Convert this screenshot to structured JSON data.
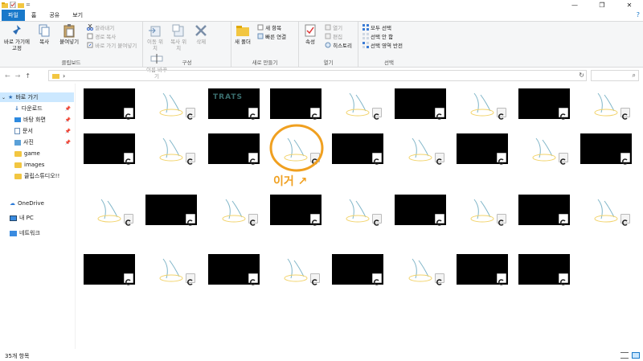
{
  "window": {
    "quick_access_arrow": "=",
    "controls": {
      "minimize": "—",
      "maximize": "❐",
      "close": "✕"
    }
  },
  "tabs": [
    {
      "label": "파일"
    },
    {
      "label": "홈"
    },
    {
      "label": "공유"
    },
    {
      "label": "보기"
    }
  ],
  "help": "?",
  "ribbon": {
    "clipboard": {
      "pin_label": "바로 가기에 고정",
      "copy_label": "복사",
      "paste_label": "붙여넣기",
      "cut_label": "잘라내기",
      "copy_path_label": "경로 복사",
      "paste_shortcut_label": "바로 가기 붙여넣기",
      "group_label": "클립보드"
    },
    "organize": {
      "move_label": "이동 위치",
      "copy_to_label": "복사 위치",
      "delete_label": "삭제",
      "rename_label": "이름 바꾸기",
      "group_label": "구성"
    },
    "new": {
      "new_folder_label": "새 폴더",
      "new_item_label": "새 항목",
      "easy_access_label": "빠른 연결",
      "group_label": "새로 만들기"
    },
    "open": {
      "properties_label": "속성",
      "open_label": "열기",
      "edit_label": "편집",
      "history_label": "히스토리",
      "group_label": "열기"
    },
    "select": {
      "select_all_label": "모두 선택",
      "select_none_label": "선택 안 함",
      "invert_label": "선택 영역 반전",
      "group_label": "선택"
    }
  },
  "address": {
    "back": "←",
    "forward": "→",
    "up": "↑",
    "chevron": "›",
    "refresh": "↻",
    "search_icon": "⌕"
  },
  "nav_pane": {
    "quick_access": "바로 가기",
    "items": [
      {
        "label": "다운로드",
        "pinned": true
      },
      {
        "label": "바탕 화면",
        "pinned": true
      },
      {
        "label": "문서",
        "pinned": true
      },
      {
        "label": "사진",
        "pinned": true
      },
      {
        "label": "game",
        "pinned": false
      },
      {
        "label": "images",
        "pinned": false
      },
      {
        "label": "클립스튜디오!!",
        "pinned": false
      }
    ],
    "onedrive": "OneDrive",
    "this_pc": "내 PC",
    "network": "네트워크"
  },
  "annotation": {
    "text": "이거 ↗"
  },
  "thumbnails": [
    {
      "kind": "dark"
    },
    {
      "kind": "sketch"
    },
    {
      "kind": "title_art",
      "text": "TRATS"
    },
    {
      "kind": "dark"
    },
    {
      "kind": "sketch"
    },
    {
      "kind": "dark"
    },
    {
      "kind": "sketch"
    },
    {
      "kind": "dark"
    },
    {
      "kind": "sketch"
    },
    {
      "kind": "dark"
    },
    {
      "kind": "sketch"
    },
    {
      "kind": "dark"
    },
    {
      "kind": "sketch_circled"
    },
    {
      "kind": "dark"
    },
    {
      "kind": "sketch"
    },
    {
      "kind": "dark"
    },
    {
      "kind": "sketch"
    },
    {
      "kind": "dark"
    },
    {
      "kind": "sketch"
    },
    {
      "kind": "dark"
    },
    {
      "kind": "sketch"
    },
    {
      "kind": "dark"
    },
    {
      "kind": "sketch"
    },
    {
      "kind": "dark"
    },
    {
      "kind": "sketch"
    },
    {
      "kind": "dark"
    },
    {
      "kind": "sketch"
    },
    {
      "kind": "dark"
    },
    {
      "kind": "sketch"
    },
    {
      "kind": "dark"
    },
    {
      "kind": "sketch"
    },
    {
      "kind": "dark"
    },
    {
      "kind": "sketch"
    },
    {
      "kind": "dark"
    },
    {
      "kind": "dark"
    }
  ],
  "status": {
    "item_count": "35개 항목"
  },
  "colors": {
    "accent": "#1979ca",
    "selection": "#cce8ff",
    "annotation": "#f0a020"
  }
}
